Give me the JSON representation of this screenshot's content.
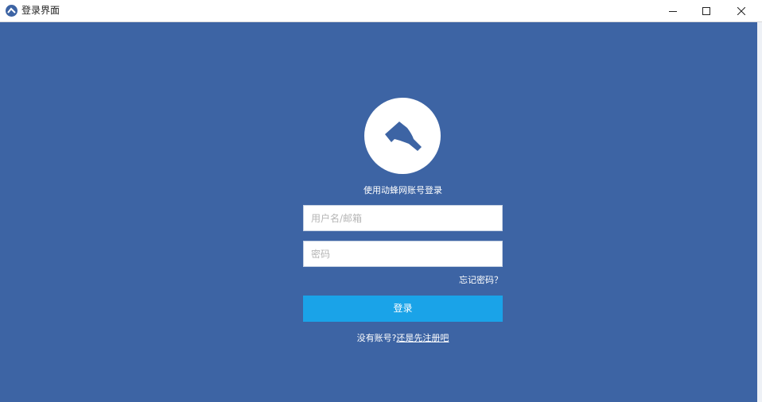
{
  "window": {
    "title": "登录界面",
    "icon": "app-logo-icon",
    "controls": {
      "minimize_icon": "minimize-icon",
      "maximize_icon": "maximize-icon",
      "close_icon": "close-icon"
    }
  },
  "colors": {
    "background": "#3d64a4",
    "button": "#1aa3e8",
    "text": "#ffffff"
  },
  "login": {
    "logo_icon": "axe-logo-icon",
    "subtitle": "使用动蜂网账号登录",
    "username_placeholder": "用户名/邮箱",
    "username_value": "",
    "password_placeholder": "密码",
    "password_value": "",
    "forgot_label": "忘记密码？",
    "submit_label": "登录",
    "no_account_text": "没有账号?",
    "register_link": "还是先注册吧"
  }
}
